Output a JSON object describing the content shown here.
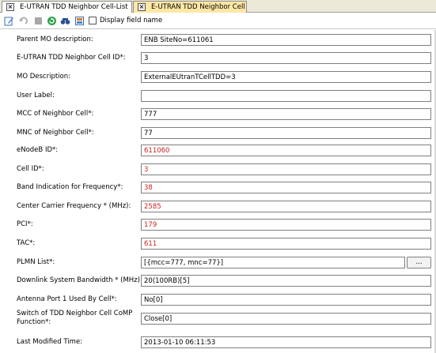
{
  "tabs": [
    {
      "label": "E-UTRAN TDD Neighbor Cell-List"
    },
    {
      "label": "E-UTRAN TDD Neighbor Cell"
    }
  ],
  "toolbar": {
    "display_field_name_label": "Display field name"
  },
  "form": {
    "fields": [
      {
        "label": "Parent MO description:",
        "value": "ENB SiteNo=611061"
      },
      {
        "label": "E-UTRAN TDD Neighbor Cell ID*:",
        "value": "3"
      },
      {
        "label": "MO Description:",
        "value": "ExternalEUtranTCellTDD=3"
      },
      {
        "label": "User Label:",
        "value": ""
      },
      {
        "label": "MCC of Neighbor Cell*:",
        "value": "777"
      },
      {
        "label": "MNC of Neighbor Cell*:",
        "value": "77"
      },
      {
        "label": "eNodeB ID*:",
        "value": "611060"
      },
      {
        "label": "Cell ID*:",
        "value": "3"
      },
      {
        "label": "Band Indication for Frequency*:",
        "value": "38"
      },
      {
        "label": "Center Carrier Frequency * (MHz):",
        "value": "2585"
      },
      {
        "label": "PCI*:",
        "value": "179"
      },
      {
        "label": "TAC*:",
        "value": "611"
      },
      {
        "label": "PLMN List*:",
        "value": "[{mcc=777, mnc=77}]",
        "button": "..."
      },
      {
        "label": "Downlink System Bandwidth * (MHz):",
        "value": "20(100RB)[5]"
      },
      {
        "label": "Antenna Port 1 Used By Cell*:",
        "value": "No[0]"
      },
      {
        "label_line1": "Switch of TDD Neighbor Cell CoMP",
        "label_line2": "Function*:",
        "value": "Close[0]"
      },
      {
        "label": "Last Modified Time:",
        "value": "2013-01-10 06:11:53"
      }
    ]
  },
  "colors": {
    "active_tab_bg": "#ffe7a5",
    "modified_value": "#cc2222"
  }
}
